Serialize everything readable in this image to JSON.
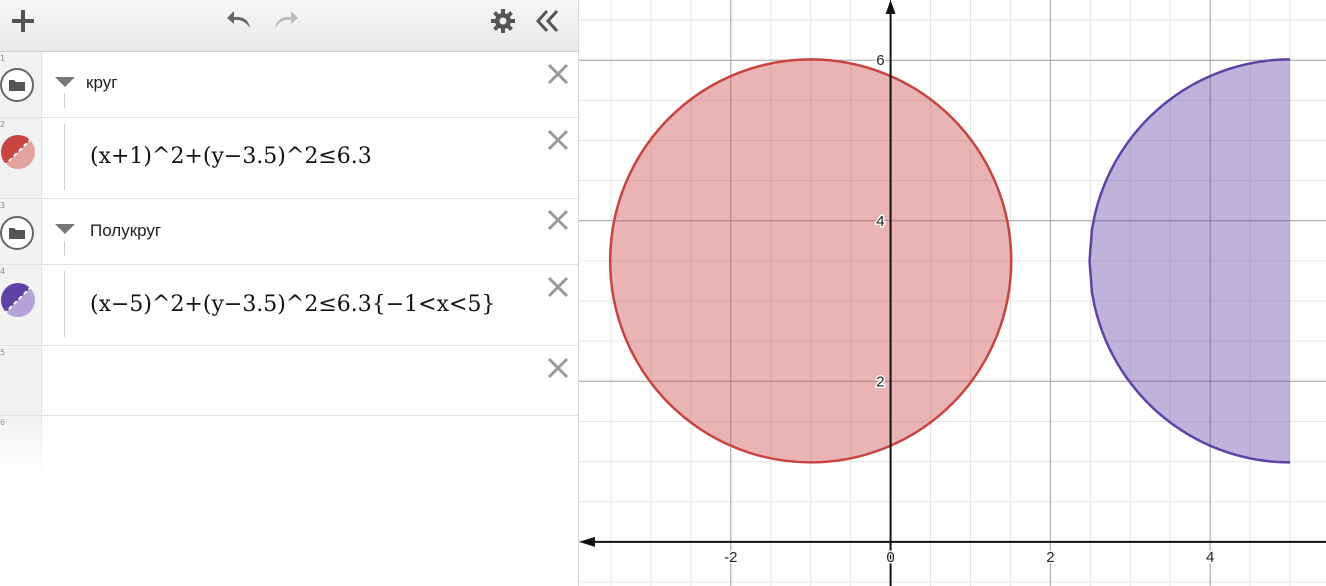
{
  "toolbar": {
    "add_icon": "plus-icon",
    "undo_icon": "undo-icon",
    "redo_icon": "redo-icon",
    "settings_icon": "gear-icon",
    "collapse_icon": "double-chevron-left-icon"
  },
  "expressions": [
    {
      "num": "1",
      "type": "folder",
      "label": "круг"
    },
    {
      "num": "2",
      "type": "expression",
      "color": "#c74440",
      "latex": "(x+1)^2+(y−3.5)^2≤6.3"
    },
    {
      "num": "3",
      "type": "folder",
      "label": "Полукруг"
    },
    {
      "num": "4",
      "type": "expression",
      "color": "#6042a6",
      "latex": "(x−5)^2+(y−3.5)^2≤6.3{−1<x<5}"
    },
    {
      "num": "5",
      "type": "empty"
    },
    {
      "num": "6",
      "type": "empty"
    }
  ],
  "graph": {
    "x_ticks": [
      "-2",
      "0",
      "2",
      "4"
    ],
    "y_ticks": [
      "2",
      "4",
      "6"
    ],
    "x_range": [
      -3.9,
      5.45
    ],
    "y_range": [
      -0.55,
      6.75
    ],
    "circle": {
      "cx": -1,
      "cy": 3.5,
      "r_squared": 6.3,
      "color": "#c74440"
    },
    "half_circle": {
      "cx": 5,
      "cy": 3.5,
      "r_squared": 6.3,
      "x_min": -1,
      "x_max": 5,
      "color": "#6042a6"
    }
  }
}
